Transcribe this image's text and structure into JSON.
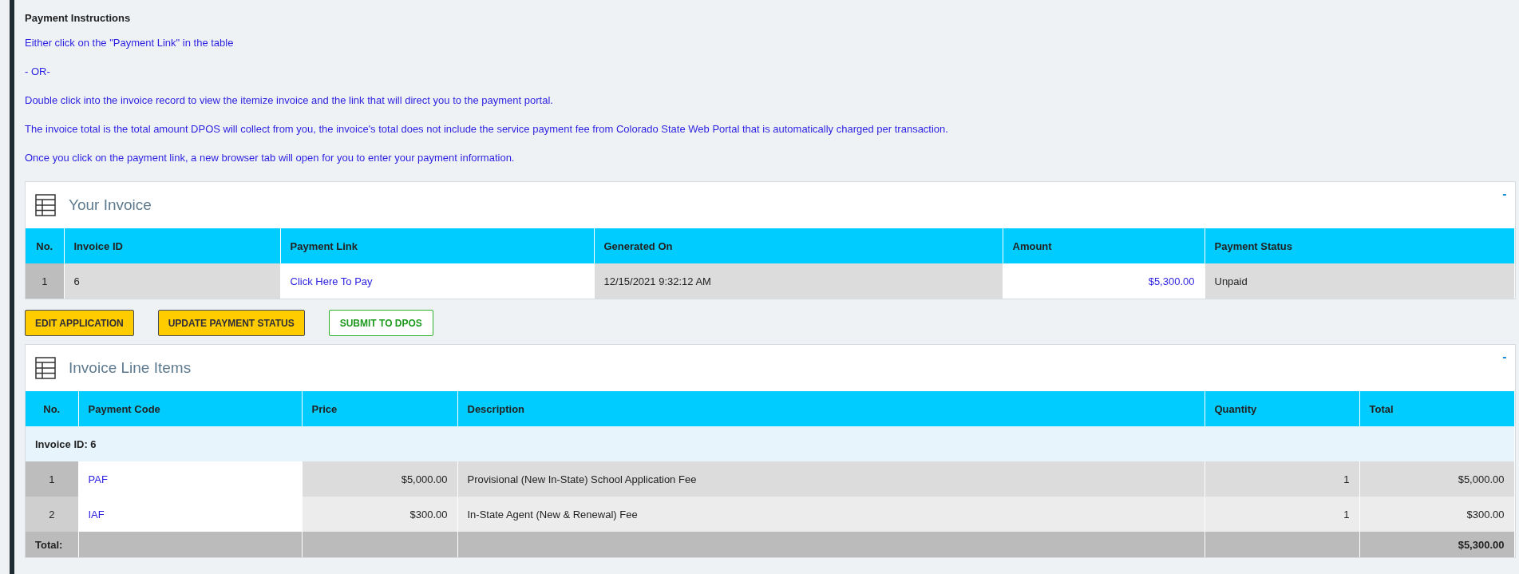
{
  "instructions": {
    "title": "Payment Instructions",
    "lines": [
      "Either click on the \"Payment Link\" in the table",
      "- OR-",
      "Double click into the invoice record to view the itemize invoice and the link that will direct you to the payment portal.",
      "The invoice total is the total amount DPOS will collect from you, the invoice's total does not include the service payment fee from Colorado State Web Portal that is automatically charged per transaction.",
      "Once you click on the payment link, a new browser tab will open for you to enter your payment information."
    ]
  },
  "invoice": {
    "title": "Your Invoice",
    "collapse": "-",
    "columns": [
      {
        "label": "No.",
        "kind": "index"
      },
      {
        "label": "Invoice ID",
        "kind": "text"
      },
      {
        "label": "Payment Link",
        "kind": "link"
      },
      {
        "label": "Generated On",
        "kind": "text"
      },
      {
        "label": "Amount",
        "kind": "link-amount"
      },
      {
        "label": "Payment Status",
        "kind": "text"
      }
    ],
    "rows": [
      [
        "1",
        "6",
        "Click Here To Pay",
        "12/15/2021 9:32:12 AM",
        "$5,300.00",
        "Unpaid"
      ]
    ]
  },
  "buttons": [
    {
      "label": "EDIT APPLICATION",
      "kind": "warning"
    },
    {
      "label": "UPDATE PAYMENT STATUS",
      "kind": "warning"
    },
    {
      "label": "SUBMIT TO DPOS",
      "kind": "success"
    }
  ],
  "line_items": {
    "title": "Invoice Line Items",
    "collapse": "-",
    "columns": [
      {
        "label": "No.",
        "kind": "index"
      },
      {
        "label": "Payment Code",
        "kind": "link"
      },
      {
        "label": "Price",
        "kind": "amount"
      },
      {
        "label": "Description",
        "kind": "text"
      },
      {
        "label": "Quantity",
        "kind": "amount"
      },
      {
        "label": "Total",
        "kind": "amount"
      }
    ],
    "group": "Invoice ID: 6",
    "rows": [
      [
        "1",
        "PAF",
        "$5,000.00",
        "Provisional (New In-State) School Application Fee",
        "1",
        "$5,000.00"
      ],
      [
        "2",
        "IAF",
        "$300.00",
        "In-State Agent (New & Renewal) Fee",
        "1",
        "$300.00"
      ]
    ],
    "total": {
      "label": "Total:",
      "value": "$5,300.00"
    }
  }
}
